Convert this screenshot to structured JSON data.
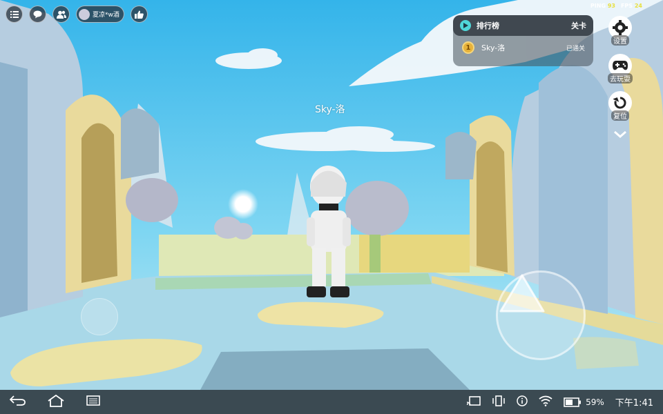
{
  "hud": {
    "profile_name": "夏凉*w酒",
    "ping_label": "PING",
    "ping_value": "93",
    "fps_label": "FPS",
    "fps_value": "24"
  },
  "leaderboard": {
    "title": "排行榜",
    "level_label": "关卡",
    "entries": [
      {
        "rank": "1",
        "player": "Sky-洛",
        "status": "已通关"
      }
    ]
  },
  "side_buttons": {
    "settings": "设置",
    "play_game": "去玩耍",
    "reset": "复位"
  },
  "player_nametag": "Sky-洛",
  "system_bar": {
    "battery": "59%",
    "time": "下午1:41"
  },
  "colors": {
    "sky": "#5cc7ee",
    "accent_teal": "#4fd7d8",
    "medal_gold": "#e7b23a",
    "ping_value": "#e8e040",
    "system_bar": "#3b4a52"
  }
}
